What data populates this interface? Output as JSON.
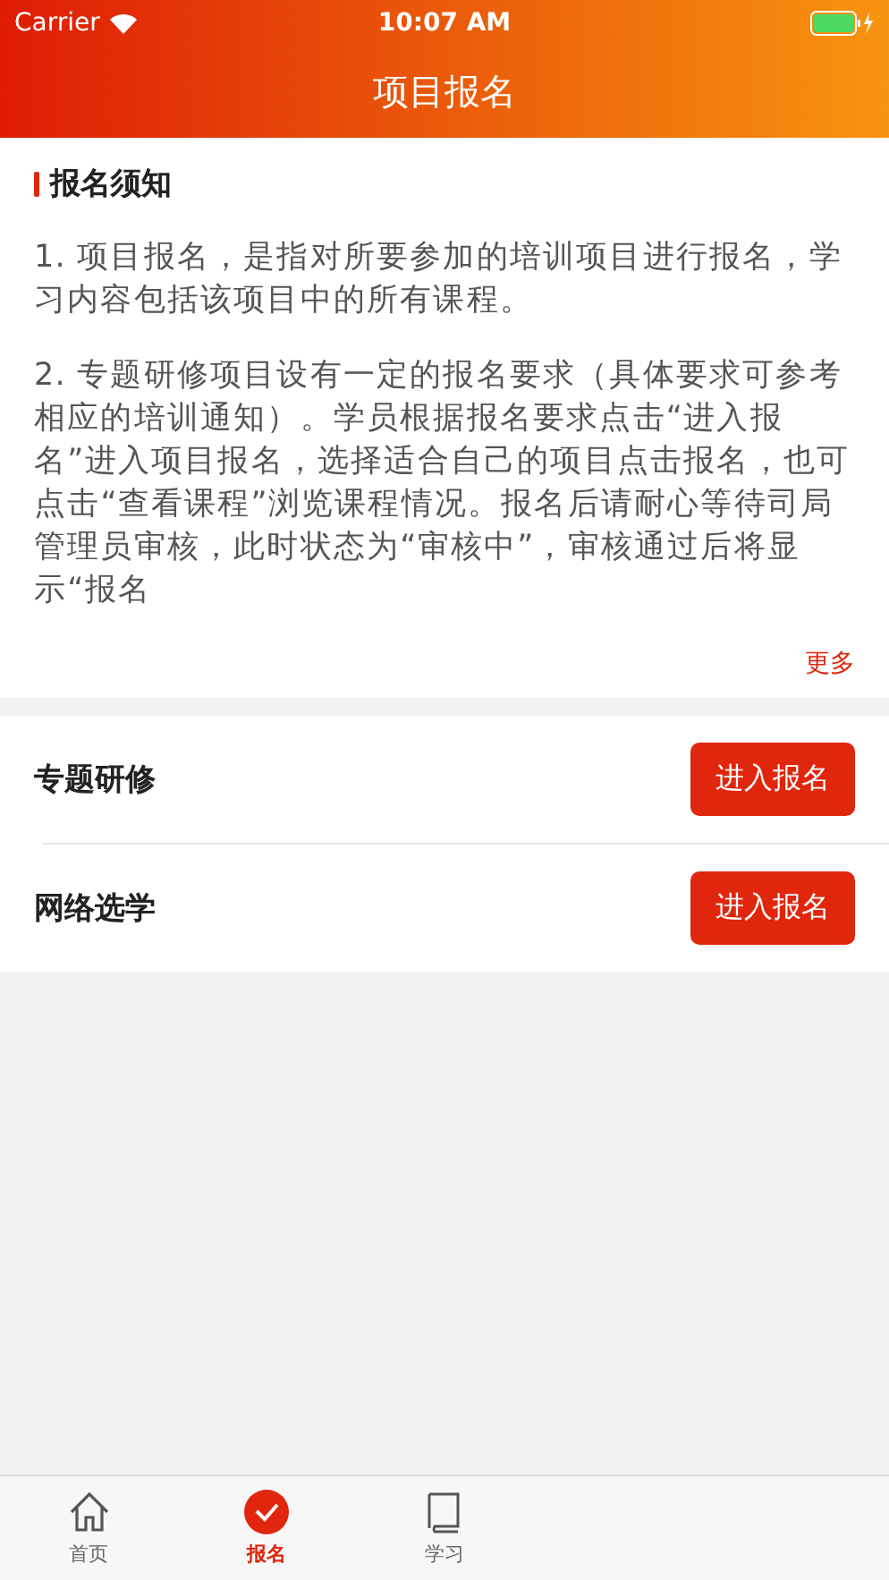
{
  "status_bar": {
    "carrier": "Carrier",
    "time": "10:07 AM"
  },
  "nav": {
    "title": "项目报名"
  },
  "notice": {
    "title": "报名须知",
    "paragraphs": [
      "1. 项目报名，是指对所要参加的培训项目进行报名，学习内容包括该项目中的所有课程。",
      "2. 专题研修项目设有一定的报名要求（具体要求可参考相应的培训通知）。学员根据报名要求点击“进入报名”进入项目报名，选择适合自己的项目点击报名，也可点击“查看课程”浏览课程情况。报名后请耐心等待司局管理员审核，此时状态为“审核中”，审核通过后将显示“报名"
    ],
    "more": "更多"
  },
  "programs": [
    {
      "name": "专题研修",
      "button": "进入报名"
    },
    {
      "name": "网络选学",
      "button": "进入报名"
    }
  ],
  "tabs": [
    {
      "label": "首页",
      "kind": "home",
      "selected": false
    },
    {
      "label": "报名",
      "kind": "check",
      "selected": true
    },
    {
      "label": "学习",
      "kind": "book",
      "selected": false
    }
  ]
}
